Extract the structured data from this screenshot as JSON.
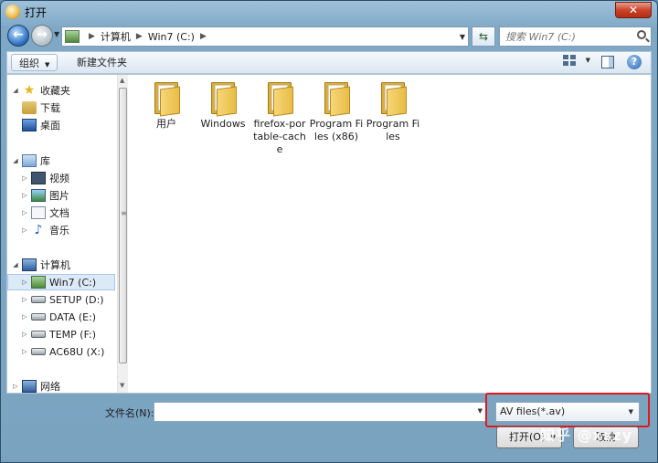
{
  "window": {
    "title": "打开",
    "close_label": "✕"
  },
  "nav": {
    "back_glyph": "←",
    "forward_glyph": "→",
    "breadcrumb": [
      "计算机",
      "Win7 (C:)"
    ],
    "search_placeholder": "搜索 Win7 (C:)"
  },
  "toolbar": {
    "organize_label": "组织",
    "new_folder_label": "新建文件夹",
    "help_glyph": "?"
  },
  "sidebar": {
    "favorites": {
      "label": "收藏夹",
      "items": [
        {
          "label": "下载",
          "icon": "download-icon"
        },
        {
          "label": "桌面",
          "icon": "desktop-icon"
        }
      ]
    },
    "libraries": {
      "label": "库",
      "items": [
        {
          "label": "视频",
          "icon": "video-icon"
        },
        {
          "label": "图片",
          "icon": "pictures-icon"
        },
        {
          "label": "文档",
          "icon": "documents-icon"
        },
        {
          "label": "音乐",
          "icon": "music-icon"
        }
      ]
    },
    "computer": {
      "label": "计算机",
      "items": [
        {
          "label": "Win7 (C:)",
          "icon": "drive-icon"
        },
        {
          "label": "SETUP (D:)",
          "icon": "drive-icon"
        },
        {
          "label": "DATA (E:)",
          "icon": "drive-icon"
        },
        {
          "label": "TEMP (F:)",
          "icon": "drive-icon"
        },
        {
          "label": "AC68U (X:)",
          "icon": "network-drive-icon"
        }
      ]
    },
    "network": {
      "label": "网络"
    }
  },
  "files": [
    {
      "name": "用户"
    },
    {
      "name": "Windows"
    },
    {
      "name": "firefox-portable-cache"
    },
    {
      "name": "Program Files (x86)"
    },
    {
      "name": "Program Files"
    }
  ],
  "footer": {
    "filename_label": "文件名(N):",
    "filename_value": "",
    "filter_value": "AV files(*.av)",
    "open_label": "打开(O)",
    "cancel_label": "取消"
  },
  "watermark": "知乎 @xszy",
  "colors": {
    "highlight": "#e0191d",
    "selection": "#dce9f7"
  }
}
